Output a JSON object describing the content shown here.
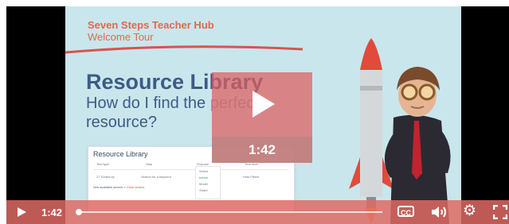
{
  "slide": {
    "hub_title": "Seven Steps Teacher Hub",
    "hub_subtitle": "Welcome Tour",
    "heading": "Resource Library",
    "question_part1": "How do I find the ",
    "question_part2": "perfect",
    "question_line2": "resource?",
    "mock": {
      "title": "Resource Library",
      "filters": [
        "Text type",
        "Step",
        "Purpose",
        "Year level"
      ],
      "sort": "27 Sorted by",
      "search": "Search for a keyword",
      "drop_items": [
        "Select",
        "Inform",
        "Model",
        "Share"
      ],
      "checkbox": "Hide Filters",
      "results": "See available search >",
      "results_link": "Clear search"
    }
  },
  "overlay": {
    "duration": "1:42"
  },
  "controls": {
    "time": "1:42",
    "cc_label": "CC",
    "progress": 0,
    "icons": [
      "play-icon",
      "closed-captions-icon",
      "volume-icon",
      "settings-gear-icon",
      "fullscreen-icon"
    ]
  }
}
